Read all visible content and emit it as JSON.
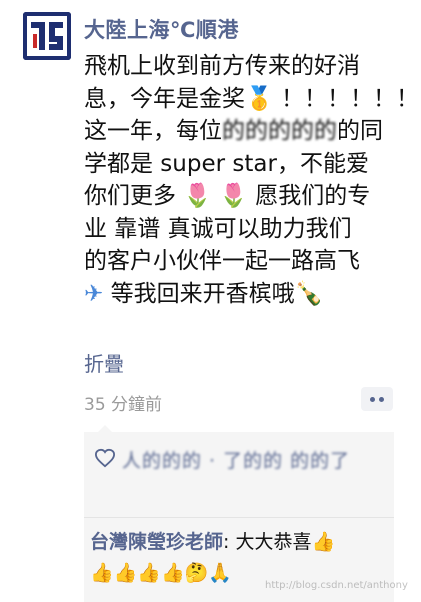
{
  "post": {
    "author": "大陸上海℃順港",
    "lines": [
      "飛机上收到前方传来的好消",
      "息，今年是金奖",
      "这一年，每位",
      "学都是 super star，不能爱",
      "你们更多",
      "业 靠谱 真诚可以助力我们",
      "的客户小伙伴一起一路高飞",
      "等我回来开香槟哦"
    ],
    "line2_suffix": " ！！！！！！",
    "line3_blur": "的的的的的",
    "line3_suffix": "的同",
    "line5_suffix": " 愿我们的专",
    "collapse_label": "折疊",
    "timestamp": "35 分鐘前"
  },
  "likes": {
    "likers_text": "人的的的 · 了的的 的的了"
  },
  "comment": {
    "commenter": "台灣陳瑩珍老師",
    "text": ": 大大恭喜",
    "reactions": "👍👍👍👍🤔🙏"
  },
  "watermark": "http://blog.csdn.net/anthony",
  "colors": {
    "link": "#56658f",
    "text": "#111111",
    "muted": "#9a9a9a",
    "box_bg": "#f5f5f5"
  },
  "icons": [
    "avatar-logo",
    "medal-icon",
    "tulip-icon",
    "plane-icon",
    "champagne-icon",
    "more-dots-icon",
    "heart-icon",
    "thumbs-up-icon"
  ]
}
